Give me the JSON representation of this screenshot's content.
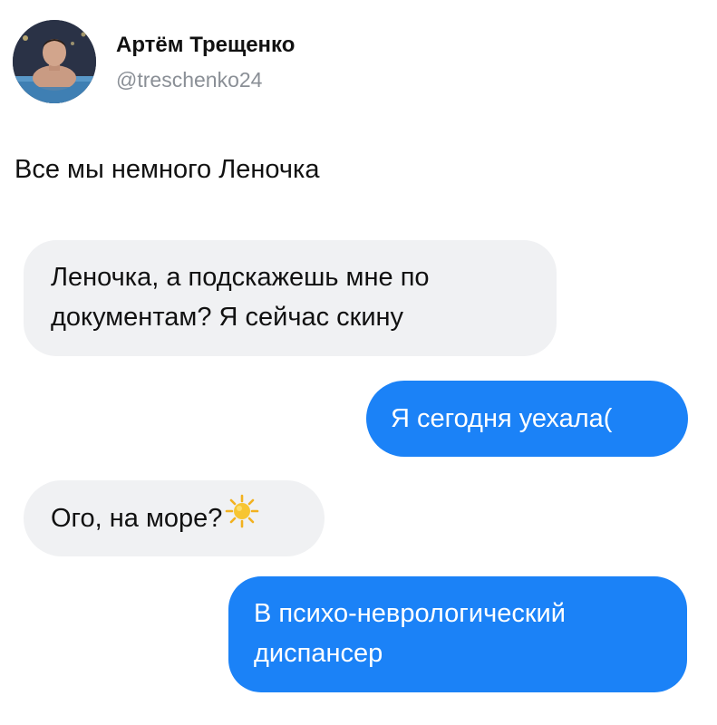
{
  "author": {
    "name": "Артём Трещенко",
    "handle": "@treschenko24"
  },
  "tweet": {
    "text": "Все мы немного Леночка"
  },
  "messages": [
    {
      "side": "incoming",
      "lines": [
        "Леночка, а подскажешь мне по",
        "документам? Я сейчас скину"
      ]
    },
    {
      "side": "outgoing",
      "lines": [
        "Я сегодня уехала("
      ]
    },
    {
      "side": "incoming",
      "lines": [
        "Ого, на море?"
      ],
      "emoji": "sun-icon"
    },
    {
      "side": "outgoing",
      "lines": [
        "В психо-неврологический",
        "диспансер"
      ]
    }
  ],
  "colors": {
    "incoming_bubble": "#f0f1f3",
    "outgoing_bubble": "#1b82f7",
    "handle_text": "#8a8f96"
  }
}
